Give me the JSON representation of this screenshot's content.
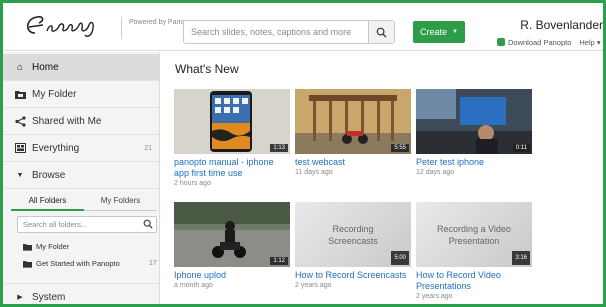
{
  "header": {
    "logo_name": "erasmus-logo",
    "powered_by": "Powered by Panopto",
    "search_placeholder": "Search slides, notes, captions and more",
    "create_label": "Create",
    "user_name": "R. Bovenlander",
    "download_label": "Download Panopto",
    "help_label": "Help"
  },
  "sidebar": {
    "items": [
      {
        "label": "Home",
        "icon": "home-icon"
      },
      {
        "label": "My Folder",
        "icon": "folder-icon"
      },
      {
        "label": "Shared with Me",
        "icon": "share-icon"
      },
      {
        "label": "Everything",
        "icon": "grid-icon",
        "count": "21"
      },
      {
        "label": "Browse",
        "icon": "caret-down-icon"
      }
    ],
    "tabs": [
      "All Folders",
      "My Folders"
    ],
    "folder_search_placeholder": "Search all folders...",
    "folders": [
      {
        "label": "My Folder"
      },
      {
        "label": "Get Started with Panopto",
        "count": "17"
      }
    ],
    "system_label": "System"
  },
  "main": {
    "title": "What's New",
    "videos": [
      {
        "title": "panopto manual - iphone app first time use",
        "meta": "2 hours ago",
        "duration": "1:13"
      },
      {
        "title": "test webcast",
        "meta": "11 days ago",
        "duration": "5:55"
      },
      {
        "title": "Peter test iphone",
        "meta": "12 days ago",
        "duration": "0:11"
      },
      {
        "title": "Iphone uplod",
        "meta": "a month ago",
        "duration": "1:12"
      },
      {
        "title": "How to Record Screencasts",
        "meta": "2 years ago",
        "duration": "5:00",
        "slide_text": "Recording Screencasts"
      },
      {
        "title": "How to Record Video Presentations",
        "meta": "2 years ago",
        "duration": "3:16",
        "slide_text": "Recording a Video Presentation"
      }
    ]
  },
  "colors": {
    "accent": "#2e9d4a",
    "link": "#1f6fc0"
  }
}
